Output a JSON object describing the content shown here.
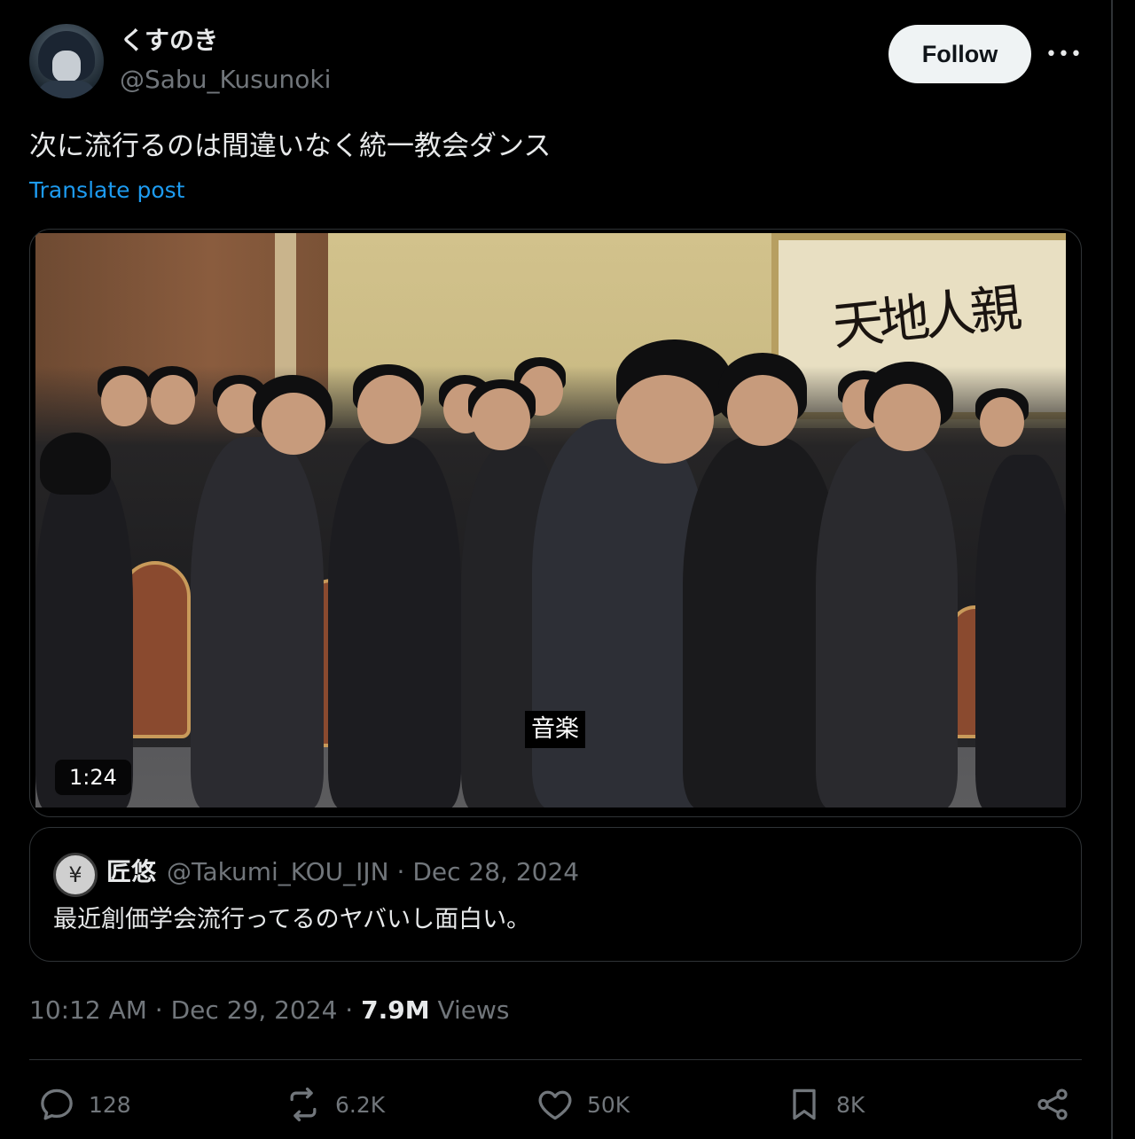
{
  "author": {
    "display_name": "くすのき",
    "handle": "@Sabu_Kusunoki"
  },
  "follow_label": "Follow",
  "more_label": "•••",
  "post": {
    "text": "次に流行るのは間違いなく統一教会ダンス",
    "translate_label": "Translate post"
  },
  "media": {
    "caption": "音楽",
    "duration": "1:24",
    "calligraphy": "天地人親"
  },
  "quoted": {
    "display_name": "匠悠",
    "handle": "@Takumi_KOU_IJN",
    "date": "Dec 28, 2024",
    "text": "最近創価学会流行ってるのヤバいし面白い。"
  },
  "meta": {
    "time": "10:12 AM",
    "date": "Dec 29, 2024",
    "views_count": "7.9M",
    "views_label": "Views"
  },
  "actions": {
    "replies": "128",
    "reposts": "6.2K",
    "likes": "50K",
    "bookmarks": "8K"
  },
  "colors": {
    "background": "#000000",
    "link": "#1d9bf0",
    "muted": "#71767b",
    "text": "#e7e9ea"
  }
}
